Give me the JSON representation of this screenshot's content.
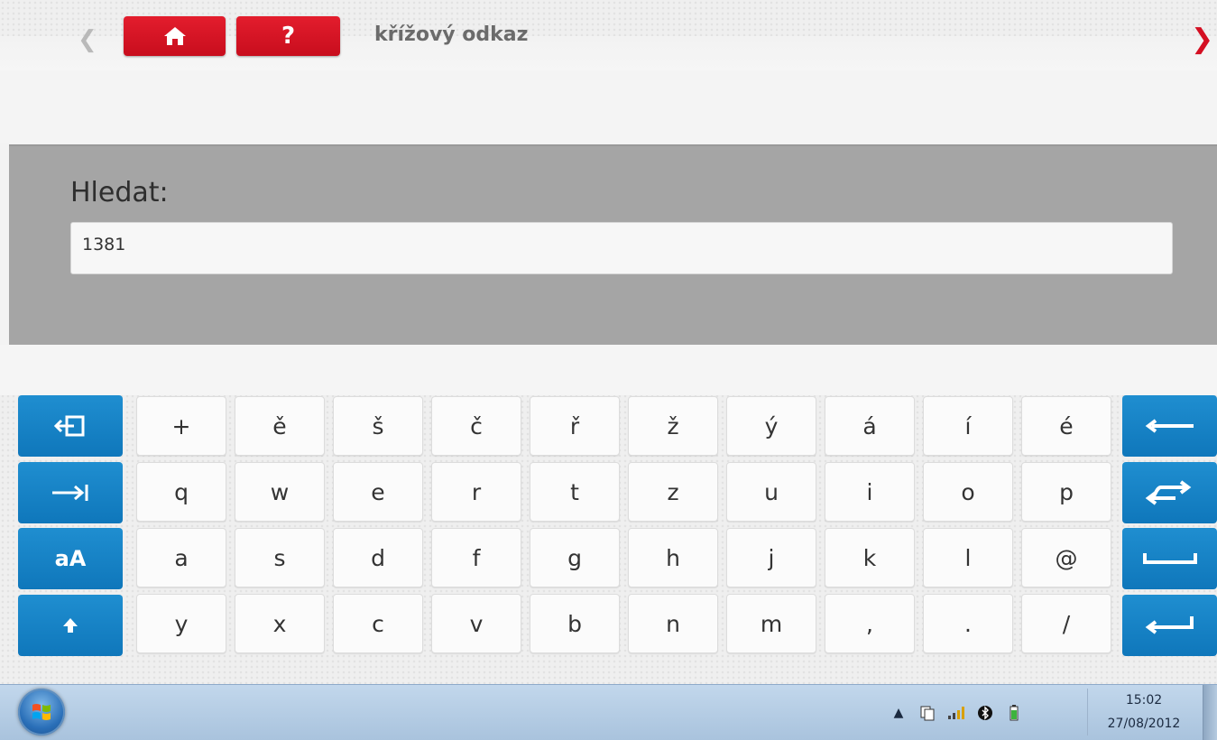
{
  "header": {
    "title": "křížový odkaz",
    "back_icon": "chevron-left-icon",
    "forward_icon": "chevron-right-icon",
    "home_icon": "home-icon",
    "help_label": "?"
  },
  "search": {
    "label": "Hledat:",
    "value": "1381"
  },
  "keyboard": {
    "rows": [
      [
        "+",
        "ě",
        "š",
        "č",
        "ř",
        "ž",
        "ý",
        "á",
        "í",
        "é"
      ],
      [
        "q",
        "w",
        "e",
        "r",
        "t",
        "z",
        "u",
        "i",
        "o",
        "p"
      ],
      [
        "a",
        "s",
        "d",
        "f",
        "g",
        "h",
        "j",
        "k",
        "l",
        "@"
      ],
      [
        "y",
        "x",
        "c",
        "v",
        "b",
        "n",
        "m",
        ",",
        ".",
        "/"
      ]
    ],
    "left_keys": [
      "exit-icon",
      "tab-icon",
      "aA",
      "shift-icon"
    ],
    "right_keys": [
      "backspace-icon",
      "swap-icon",
      "space-icon",
      "enter-icon"
    ]
  },
  "taskbar": {
    "time": "15:02",
    "date": "27/08/2012",
    "tray_icons": [
      "show-hidden-icon",
      "network-icon",
      "signal-icon",
      "bluetooth-icon",
      "battery-icon"
    ]
  },
  "colors": {
    "accent_red": "#d40f22",
    "key_blue": "#1580c3",
    "panel_gray": "#a5a5a5"
  }
}
